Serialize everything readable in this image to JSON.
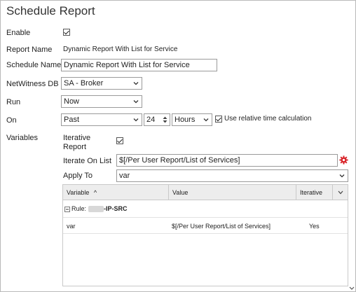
{
  "dialog": {
    "title": "Schedule Report"
  },
  "form": {
    "enable": {
      "label": "Enable",
      "checked": true
    },
    "report_name": {
      "label": "Report Name",
      "value": "Dynamic Report With List for Service"
    },
    "schedule_name": {
      "label": "Schedule Name",
      "value": "Dynamic Report With List for Service"
    },
    "netwitness_db": {
      "label": "NetWitness DB",
      "value": "SA - Broker"
    },
    "run": {
      "label": "Run",
      "value": "Now"
    },
    "on": {
      "label": "On",
      "range": "Past",
      "amount": "24",
      "unit": "Hours",
      "relative_label": "Use relative time calculation",
      "relative_checked": true
    },
    "variables": {
      "label": "Variables",
      "iterative_label_1": "Iterative",
      "iterative_label_2": "Report",
      "iterative_checked": true,
      "iterate_on_list_label": "Iterate On List",
      "iterate_on_list_value": "$[/Per User Report/List of Services]",
      "apply_to_label": "Apply To",
      "apply_to_value": "var"
    }
  },
  "grid": {
    "columns": [
      "Variable",
      "Value",
      "Iterative"
    ],
    "sort_indicator": "^",
    "group": {
      "prefix": "Rule:",
      "suffix": "-IP-SRC"
    },
    "rows": [
      {
        "variable": "var",
        "value": "$[/Per User Report/List of Services]",
        "iterative": "Yes"
      }
    ]
  },
  "colors": {
    "gear": "#d9262c",
    "border": "#9a9a9a",
    "header_bg": "#ededed"
  },
  "icons": [
    "checkbox-checked-icon",
    "chevron-down-icon",
    "spinner-icon",
    "gear-icon",
    "collapse-icon",
    "scrollbar-button"
  ]
}
